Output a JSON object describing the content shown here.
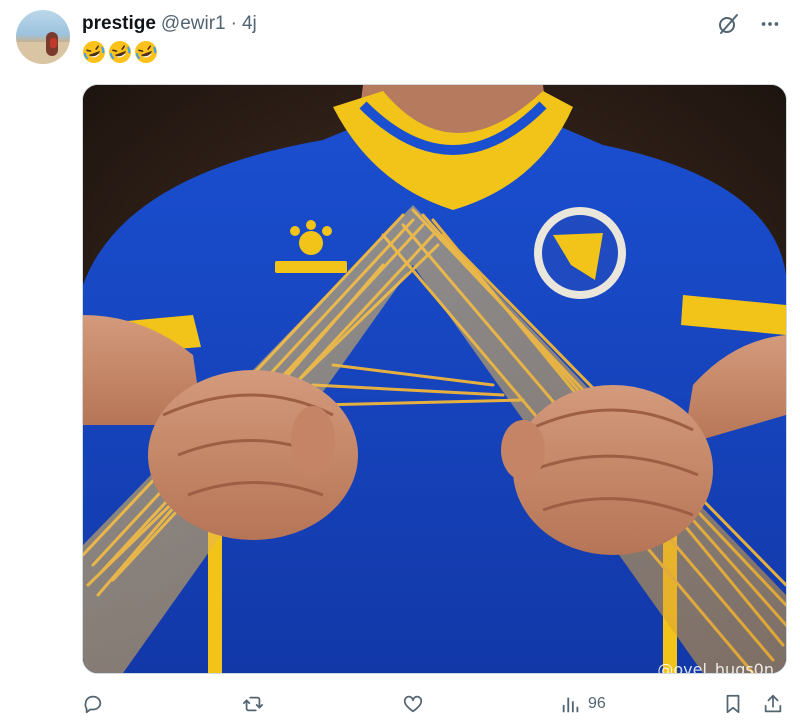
{
  "tweet": {
    "author_name": "prestige",
    "handle": "@ewir1",
    "separator": "·",
    "time": "4j",
    "emoji_text": "🤣🤣🤣",
    "watermark": "@ovel_hugs0n"
  },
  "actions": {
    "reply": {
      "icon": "reply-icon"
    },
    "retweet": {
      "icon": "retweet-icon"
    },
    "like": {
      "icon": "heart-icon"
    },
    "views": {
      "icon": "views-icon",
      "count": "96"
    },
    "bookmark": {
      "icon": "bookmark-icon"
    },
    "share": {
      "icon": "share-icon"
    }
  },
  "header_icons": [
    "grok-icon",
    "more-icon"
  ],
  "colors": {
    "text": "#0f1419",
    "muted": "#536471",
    "shirt_blue": "#1747c4",
    "shirt_yellow": "#f2c318",
    "pasta": "#e8b544",
    "skin": "#c98b6c"
  }
}
